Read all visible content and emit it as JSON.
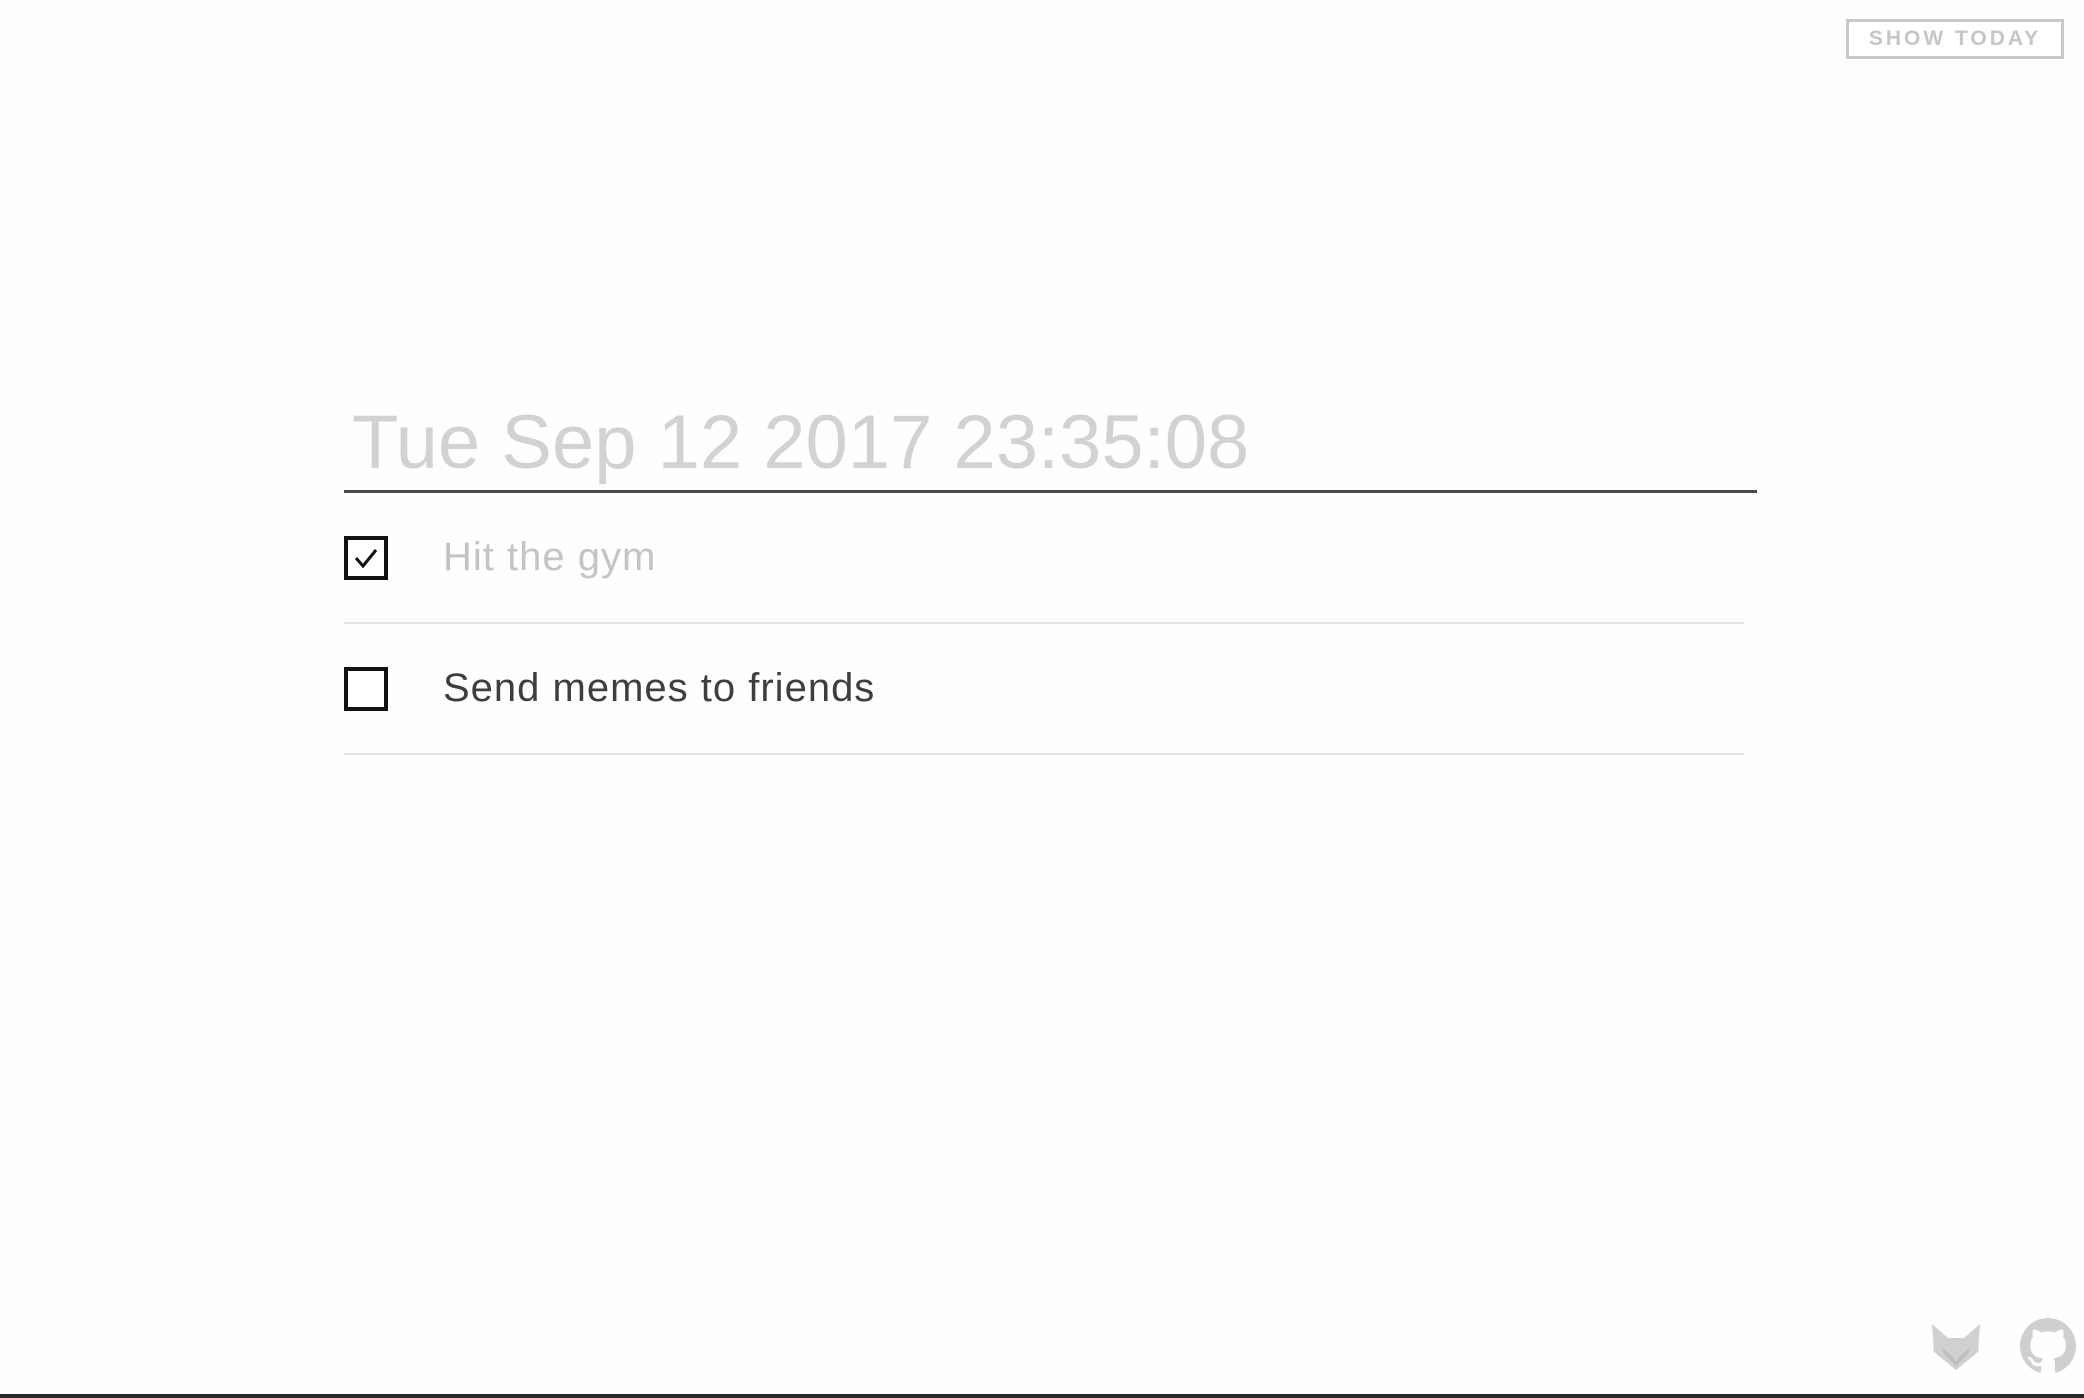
{
  "header": {
    "show_today_label": "SHOW TODAY"
  },
  "main": {
    "title_placeholder": "Tue Sep 12 2017 23:35:08"
  },
  "todos": [
    {
      "text": "Hit the gym",
      "checked": true
    },
    {
      "text": "Send memes to friends",
      "checked": false
    }
  ],
  "footer": {
    "icons": [
      "fox-icon",
      "github-icon"
    ]
  },
  "colors": {
    "accent": "#4a4a4a",
    "muted": "#c6c6c6",
    "text": "#3e3e3e"
  }
}
